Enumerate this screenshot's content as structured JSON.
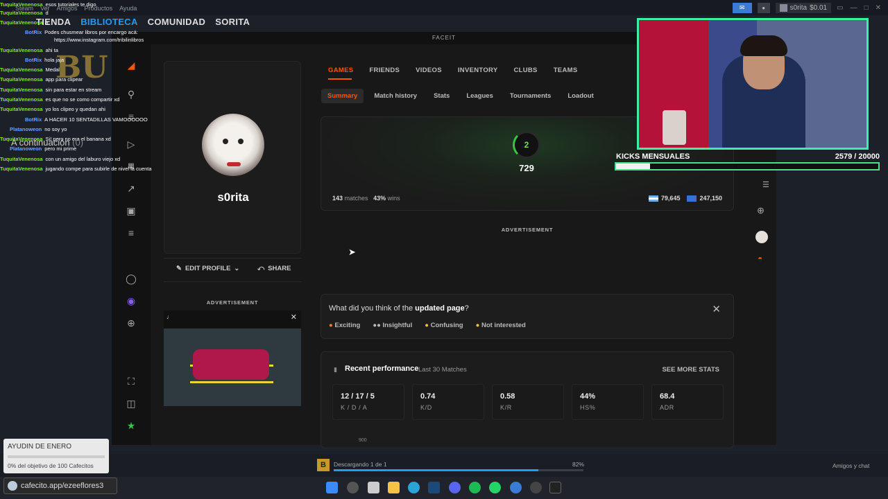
{
  "steam": {
    "menu": [
      "Steam",
      "Ver",
      "Amigos",
      "Productos",
      "Ayuda"
    ],
    "nav": [
      "TIENDA",
      "BIBLIOTECA",
      "COMUNIDAD",
      "SORITA"
    ],
    "account_name": "s0rita",
    "balance": "$0.01"
  },
  "faceit": {
    "window_title": "FACEIT",
    "username": "s0rita",
    "edit_profile": "EDIT PROFILE",
    "share": "SHARE",
    "ad_label": "ADVERTISEMENT",
    "main_tabs": [
      "GAMES",
      "FRIENDS",
      "VIDEOS",
      "INVENTORY",
      "CLUBS",
      "TEAMS"
    ],
    "sub_tabs": [
      "Summary",
      "Match history",
      "Stats",
      "Leagues",
      "Tournaments",
      "Loadout"
    ],
    "level": "2",
    "elo": "729",
    "matches_count": "143",
    "matches_label": "matches",
    "wins_pct": "43%",
    "wins_label": "wins",
    "country_rank": "79,645",
    "region_rank": "247,150",
    "feedback": {
      "question_prefix": "What did you think of the ",
      "question_bold": "updated page",
      "question_suffix": "?",
      "options": [
        "Exciting",
        "Insightful",
        "Confusing",
        "Not interested"
      ]
    },
    "performance": {
      "title": "Recent performance",
      "subtitle": "Last 30 Matches",
      "see_more": "SEE MORE STATS",
      "stats": [
        {
          "value": "12 / 17 / 5",
          "label": "K / D / A"
        },
        {
          "value": "0.74",
          "label": "K/D"
        },
        {
          "value": "0.58",
          "label": "K/R"
        },
        {
          "value": "44%",
          "label": "HS%"
        },
        {
          "value": "68.4",
          "label": "ADR"
        }
      ],
      "next_row_value": "900"
    }
  },
  "stream": {
    "kicks_label": "KICKS MENSUALES",
    "kicks_value": "2579  / 20000",
    "kicks_progress": 0.129,
    "continue_text": "A continuación",
    "continue_count": "(0)",
    "donation_title": "AYUDIN DE ENERO",
    "donation_sub": "0% del objetivo de 100 Cafecitos",
    "cafecito": "cafecito.app/ezeeflores3",
    "chat": [
      {
        "user": "TuquitaVenenosa",
        "text": "esos tutoriales te digo"
      },
      {
        "user": "TuquitaVenenosa",
        "text": "d"
      },
      {
        "user": "TuquitaVenenosa",
        "text": "a"
      },
      {
        "user": "BotRix",
        "text": "Podes chusmear libros por encargo acá:"
      },
      {
        "user": "",
        "text": "https://www.instagram.com/tribilinlibros"
      },
      {
        "user": "TuquitaVenenosa",
        "text": "ahi ta"
      },
      {
        "user": "BotRix",
        "text": "hola jaja"
      },
      {
        "user": "TuquitaVenenosa",
        "text": "Medal"
      },
      {
        "user": "TuquitaVenenosa",
        "text": "app para clipear"
      },
      {
        "user": "TuquitaVenenosa",
        "text": "sin para estar en stream"
      },
      {
        "user": "TuquitaVenenosa",
        "text": "es que no se como compartir xd"
      },
      {
        "user": "TuquitaVenenosa",
        "text": "yo los clipeo y quedan ahi"
      },
      {
        "user": "BotRix",
        "text": "A HACER 10 SENTADILLAS VAMOOOOOO"
      },
      {
        "user": "Platanoweon",
        "text": "no soy yo"
      },
      {
        "user": "TuquitaVenenosa",
        "text": "Si! pero no era el banana xd"
      },
      {
        "user": "Platanoweon",
        "text": "pero mi prime"
      },
      {
        "user": "TuquitaVenenosa",
        "text": "con un amigo del laburo viejo xd"
      },
      {
        "user": "TuquitaVenenosa",
        "text": "jugando compe para subirle de nivel la cuenta"
      }
    ]
  },
  "download": {
    "text": "Descargando 1 de 1",
    "percent": "82%",
    "progress": 0.82,
    "friends_chat": "Amigos y chat"
  },
  "colors": {
    "accent": "#ff5500",
    "steam_blue": "#1a9fff",
    "level_green": "#37c449",
    "chat_user": "#8ae24a",
    "webcam_border": "#3cf0a0"
  }
}
